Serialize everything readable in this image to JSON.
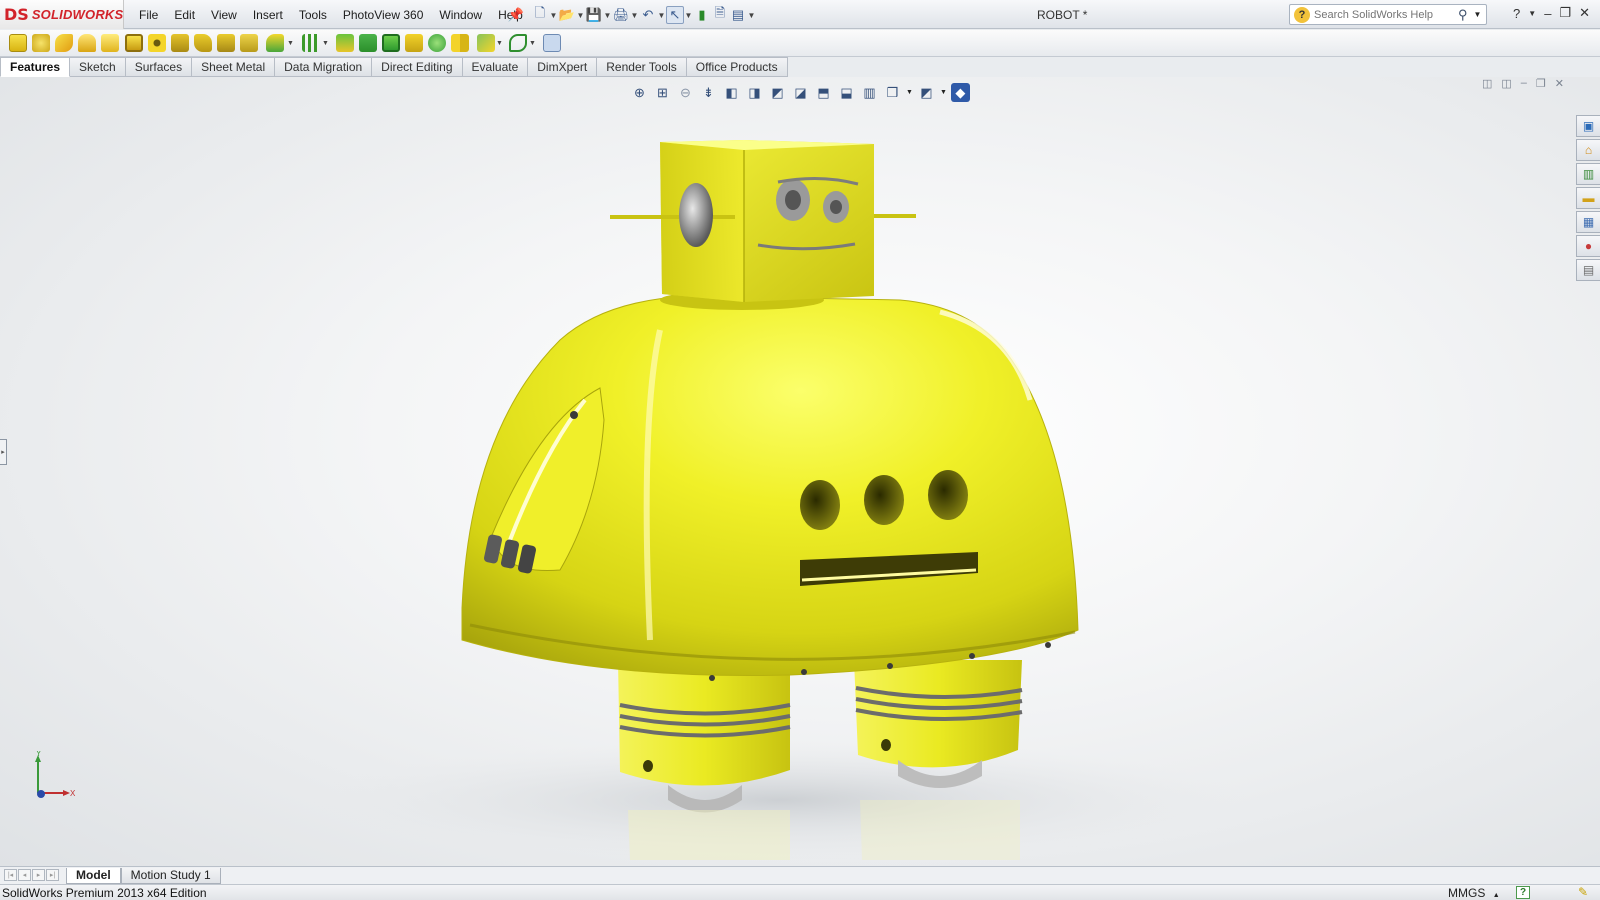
{
  "app": {
    "logo": {
      "mark": "DS",
      "word": "SOLIDWORKS"
    },
    "document_title": "ROBOT *"
  },
  "menu": [
    "File",
    "Edit",
    "View",
    "Insert",
    "Tools",
    "PhotoView 360",
    "Window",
    "Help"
  ],
  "search": {
    "placeholder": "Search SolidWorks Help"
  },
  "command_tabs": [
    {
      "label": "Features",
      "active": true
    },
    {
      "label": "Sketch",
      "active": false
    },
    {
      "label": "Surfaces",
      "active": false
    },
    {
      "label": "Sheet Metal",
      "active": false
    },
    {
      "label": "Data Migration",
      "active": false
    },
    {
      "label": "Direct Editing",
      "active": false
    },
    {
      "label": "Evaluate",
      "active": false
    },
    {
      "label": "DimXpert",
      "active": false
    },
    {
      "label": "Render Tools",
      "active": false
    },
    {
      "label": "Office Products",
      "active": false
    }
  ],
  "viewport": {
    "triad": {
      "y_label": "Y",
      "x_label": "X"
    }
  },
  "bottom_tabs": [
    {
      "label": "Model",
      "active": true
    },
    {
      "label": "Motion Study 1",
      "active": false
    }
  ],
  "status": {
    "edition": "SolidWorks Premium 2013 x64 Edition",
    "units": "MMGS",
    "units_arrow": "▲",
    "help": "?"
  },
  "colors": {
    "model_yellow": "#e8e81a",
    "brand_red": "#d2232a",
    "selection_blue": "#2f5aa8"
  },
  "icons": {
    "window_controls": [
      "help-icon",
      "minimize-icon",
      "restore-icon",
      "close-icon"
    ],
    "task_pane": [
      "solidworks-resources-icon",
      "design-library-icon",
      "file-explorer-icon",
      "view-palette-icon",
      "appearances-icon",
      "custom-properties-icon"
    ]
  }
}
